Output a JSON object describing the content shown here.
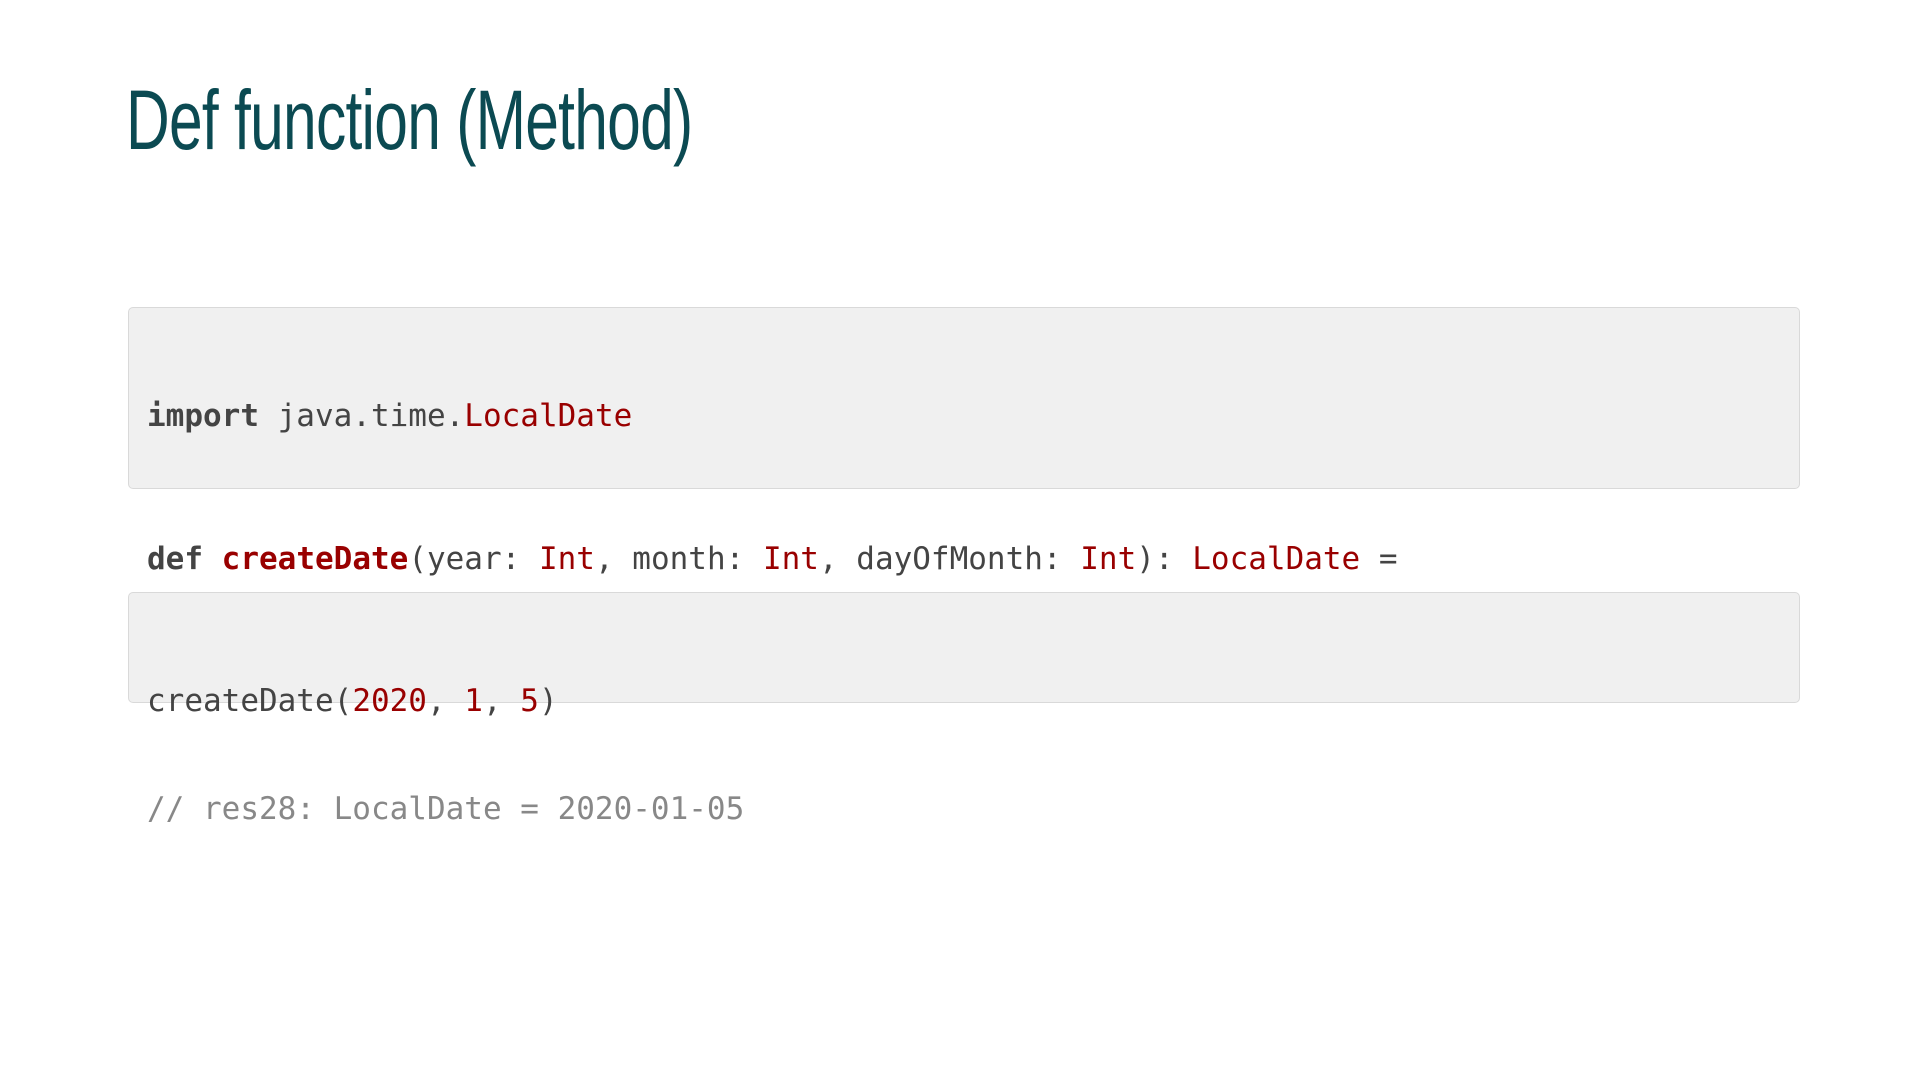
{
  "slide": {
    "title": "Def function (Method)"
  },
  "code_block_1": {
    "line1": {
      "keyword": "import",
      "text": " java.time.",
      "type": "LocalDate"
    },
    "line2": {
      "keyword": "def",
      "space": " ",
      "function_name": "createDate",
      "part1": "(year: ",
      "type1": "Int",
      "part2": ", month: ",
      "type2": "Int",
      "part3": ", dayOfMonth: ",
      "type3": "Int",
      "part4": "): ",
      "return_type": "LocalDate",
      "part5": " ="
    },
    "line3": {
      "text": "  ..."
    }
  },
  "code_block_2": {
    "line1": {
      "call": "createDate(",
      "arg1": "2020",
      "sep1": ", ",
      "arg2": "1",
      "sep2": ", ",
      "arg3": "5",
      "close": ")"
    },
    "line2": {
      "comment": "// res28: LocalDate = 2020-01-05"
    }
  },
  "colors": {
    "title": "#0b4a52",
    "keyword": "#444444",
    "type": "#990000",
    "number": "#990000",
    "comment": "#888888",
    "code_background": "#f0f0f0"
  }
}
